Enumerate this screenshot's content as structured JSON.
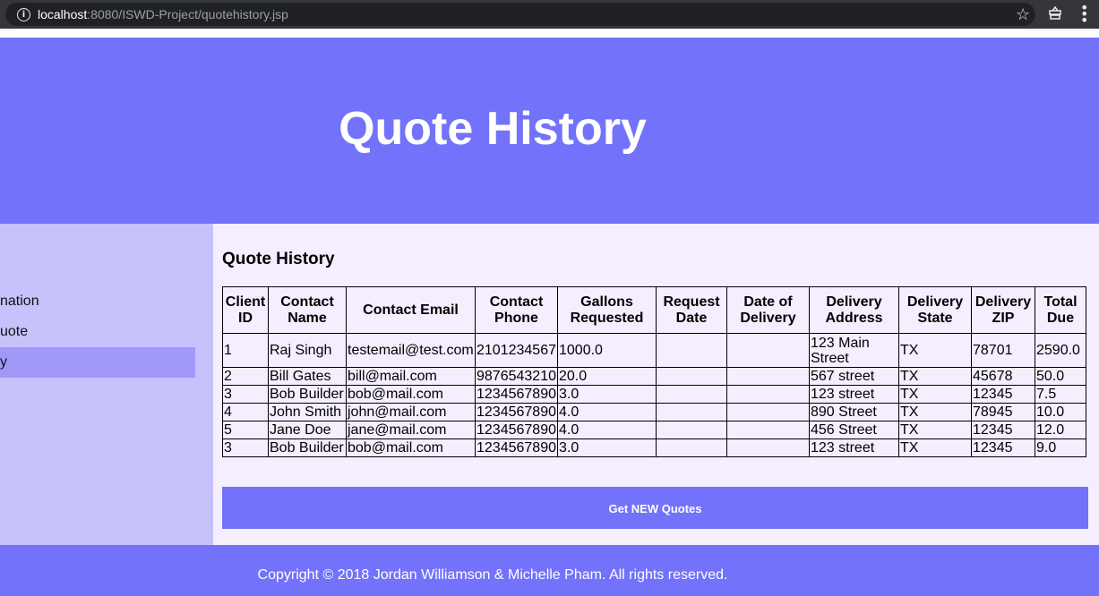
{
  "browser": {
    "url_host": "localhost",
    "url_path": ":8080/ISWD-Project/quotehistory.jsp",
    "star_icon": "star-icon",
    "extension_icon": "extension-icon",
    "menu_icon": "kebab-menu-icon"
  },
  "header": {
    "title": "Quote History"
  },
  "sidebar": {
    "items": [
      {
        "label": "nation",
        "active": false
      },
      {
        "label": "uote",
        "active": false
      },
      {
        "label": "y",
        "active": true
      }
    ]
  },
  "main": {
    "heading": "Quote History",
    "table": {
      "headers": [
        "Client ID",
        "Contact Name",
        "Contact Email",
        "Contact Phone",
        "Gallons Requested",
        "Request Date",
        "Date of Delivery",
        "Delivery Address",
        "Delivery State",
        "Delivery ZIP",
        "Total Due"
      ],
      "rows": [
        [
          "1",
          "Raj Singh",
          "testemail@test.com",
          "2101234567",
          "1000.0",
          "",
          "",
          "123 Main Street",
          "TX",
          "78701",
          "2590.0"
        ],
        [
          "2",
          "Bill Gates",
          "bill@mail.com",
          "9876543210",
          "20.0",
          "",
          "",
          "567 street",
          "TX",
          "45678",
          "50.0"
        ],
        [
          "3",
          "Bob Builder",
          "bob@mail.com",
          "1234567890",
          "3.0",
          "",
          "",
          "123 street",
          "TX",
          "12345",
          "7.5"
        ],
        [
          "4",
          "John Smith",
          "john@mail.com",
          "1234567890",
          "4.0",
          "",
          "",
          "890 Street",
          "TX",
          "78945",
          "10.0"
        ],
        [
          "5",
          "Jane Doe",
          "jane@mail.com",
          "1234567890",
          "4.0",
          "",
          "",
          "456 Street",
          "TX",
          "12345",
          "12.0"
        ],
        [
          "3",
          "Bob Builder",
          "bob@mail.com",
          "1234567890",
          "3.0",
          "",
          "",
          "123 street",
          "TX",
          "12345",
          "9.0"
        ]
      ]
    },
    "button_label": "Get NEW Quotes"
  },
  "footer": {
    "text": "Copyright © 2018 Jordan Williamson & Michelle Pham. All rights reserved."
  },
  "colors": {
    "header_bg": "#7272fb",
    "sidebar_bg": "#c7c2fc",
    "sidebar_active_bg": "#a199f9",
    "content_bg": "#f4eeff"
  }
}
